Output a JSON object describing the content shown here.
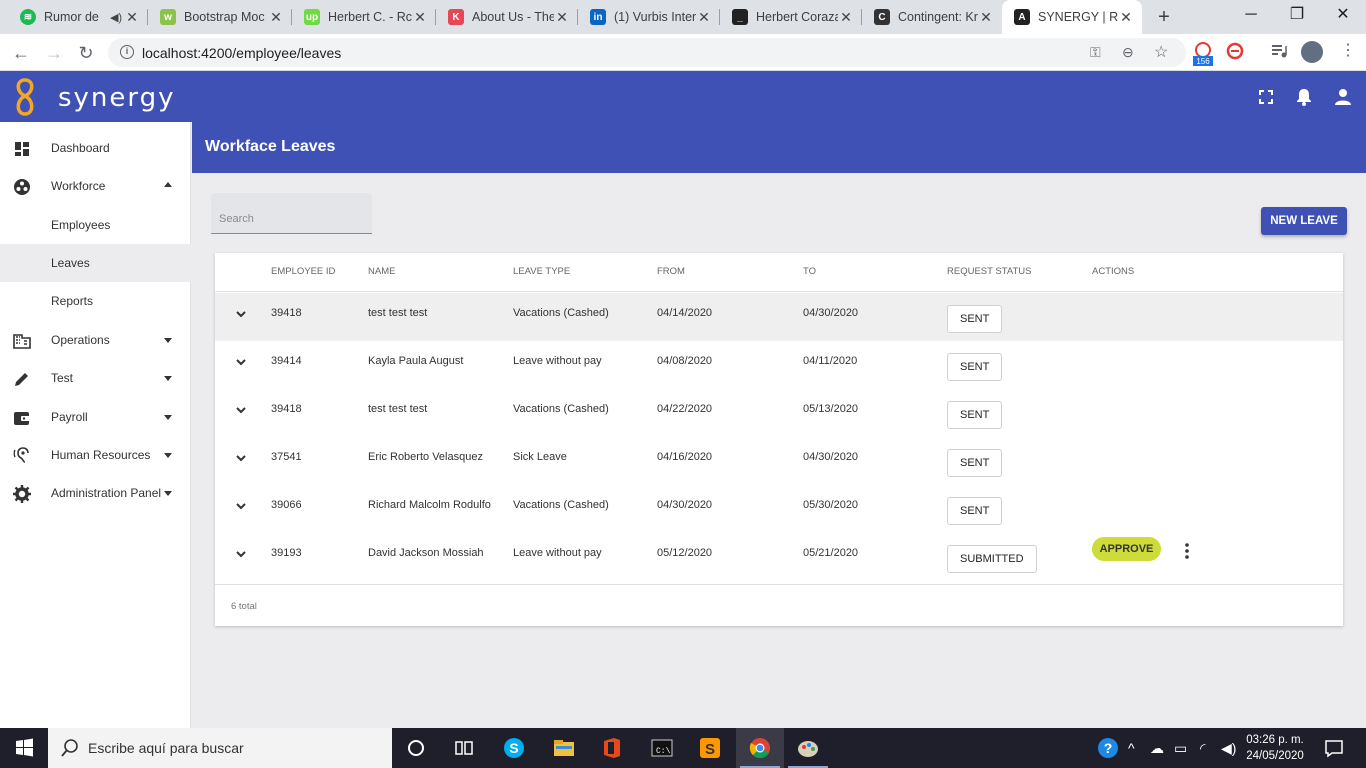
{
  "browser": {
    "tabs": [
      {
        "title": "Rumor de",
        "icon": "spotify-icon",
        "color": "#1db954",
        "muted": true
      },
      {
        "title": "Bootstrap Moc",
        "icon": "w3-icon",
        "color": "#8bc34a"
      },
      {
        "title": "Herbert C. - Rc",
        "icon": "upwork-icon",
        "color": "#6fda44"
      },
      {
        "title": "About Us - The",
        "icon": "kotlin-icon",
        "color": "#e44857"
      },
      {
        "title": "(1) Vurbis Inter",
        "icon": "linkedin-icon",
        "color": "#0a66c2"
      },
      {
        "title": "Herbert Coraza",
        "icon": "terminal-icon",
        "color": "#222222"
      },
      {
        "title": "Contingent: Kr",
        "icon": "contingent-icon",
        "color": "#333333"
      },
      {
        "title": "SYNERGY | RC",
        "icon": "angular-icon",
        "color": "#222222",
        "active": true
      }
    ],
    "url": "localhost:4200/employee/leaves",
    "ext_badge": "156"
  },
  "app": {
    "brand": "synergy",
    "brand_color": "#3f51b5",
    "accent": "#cddc39"
  },
  "sidebar": {
    "items": [
      {
        "label": "Dashboard",
        "icon": "dashboard-icon"
      },
      {
        "label": "Workforce",
        "icon": "workforce-icon",
        "expanded": true
      },
      {
        "label": "Employees"
      },
      {
        "label": "Leaves",
        "selected": true
      },
      {
        "label": "Reports"
      },
      {
        "label": "Operations",
        "icon": "building-icon"
      },
      {
        "label": "Test",
        "icon": "pencil-icon"
      },
      {
        "label": "Payroll",
        "icon": "wallet-icon"
      },
      {
        "label": "Human Resources",
        "icon": "hearing-icon"
      },
      {
        "label": "Administration Panel",
        "icon": "gear-icon"
      }
    ]
  },
  "page": {
    "title": "Workface Leaves",
    "search_placeholder": "Search",
    "new_leave_label": "NEW LEAVE"
  },
  "table": {
    "columns": [
      "EMPLOYEE ID",
      "NAME",
      "LEAVE TYPE",
      "FROM",
      "TO",
      "REQUEST STATUS",
      "ACTIONS"
    ],
    "rows": [
      {
        "id": "39418",
        "name": "test test test",
        "type": "Vacations (Cashed)",
        "from": "04/14/2020",
        "to": "04/30/2020",
        "status": "SENT"
      },
      {
        "id": "39414",
        "name": "Kayla Paula August",
        "type": "Leave without pay",
        "from": "04/08/2020",
        "to": "04/11/2020",
        "status": "SENT"
      },
      {
        "id": "39418",
        "name": "test test test",
        "type": "Vacations (Cashed)",
        "from": "04/22/2020",
        "to": "05/13/2020",
        "status": "SENT"
      },
      {
        "id": "37541",
        "name": "Eric Roberto Velasquez",
        "type": "Sick Leave",
        "from": "04/16/2020",
        "to": "04/30/2020",
        "status": "SENT"
      },
      {
        "id": "39066",
        "name": "Richard Malcolm Rodulfo",
        "type": "Vacations (Cashed)",
        "from": "04/30/2020",
        "to": "05/30/2020",
        "status": "SENT"
      },
      {
        "id": "39193",
        "name": "David Jackson Mossiah",
        "type": "Leave without pay",
        "from": "05/12/2020",
        "to": "05/21/2020",
        "status": "SUBMITTED",
        "action": "APPROVE"
      }
    ],
    "total_text": "6 total"
  },
  "taskbar": {
    "search_placeholder": "Escribe aquí para buscar",
    "time": "03:26 p. m.",
    "date": "24/05/2020"
  }
}
